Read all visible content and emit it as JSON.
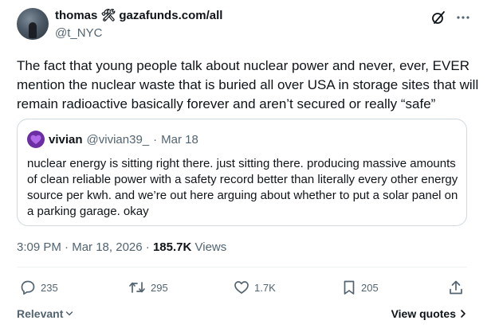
{
  "author": {
    "name": "thomas",
    "name_emoji": "🛠",
    "name_suffix": "gazafunds.com/all",
    "handle": "@t_NYC"
  },
  "tweet": {
    "text": "The fact that young people talk about nuclear power and never, ever, EVER mention the nuclear waste that is buried all over USA in storage sites that will remain radioactive basically forever and aren’t secured or really “safe”"
  },
  "quote": {
    "name": "vivian",
    "handle": "@vivian39_",
    "separator": "·",
    "date": "Mar 18",
    "text": "nuclear energy is sitting right there. just sitting there. producing massive amounts of clean reliable power with a safety record better than literally every other energy source per kwh. and we’re out here arguing about whether to put a solar panel on a parking garage. okay"
  },
  "meta": {
    "time": "3:09 PM",
    "separator": "·",
    "date": "Mar 18, 2026",
    "views_count": "185.7K",
    "views_label": "Views"
  },
  "actions": {
    "replies": "235",
    "reposts": "295",
    "likes": "1.7K",
    "bookmarks": "205"
  },
  "footer": {
    "sort_label": "Relevant",
    "view_quotes_label": "View quotes"
  },
  "colors": {
    "text_primary": "#0f1419",
    "text_secondary": "#536471",
    "border": "#cfd9de",
    "quote_avatar": "#6b2fa3"
  },
  "icons": [
    "grok-icon",
    "more-icon",
    "reply-icon",
    "repost-icon",
    "like-icon",
    "bookmark-icon",
    "share-icon",
    "chevron-down-icon",
    "chevron-right-icon"
  ]
}
